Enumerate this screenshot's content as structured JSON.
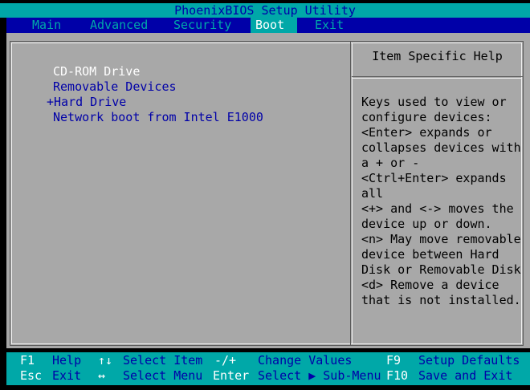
{
  "title": "PhoenixBIOS Setup Utility",
  "menu": {
    "tabs": [
      "Main",
      "Advanced",
      "Security",
      "Boot",
      "Exit"
    ],
    "active": "Boot"
  },
  "boot_order": {
    "items": [
      {
        "label": "CD-ROM Drive",
        "selected": true
      },
      {
        "label": "Removable Devices",
        "selected": false
      },
      {
        "label": "+Hard Drive",
        "selected": false
      },
      {
        "label": "Network boot from Intel E1000",
        "selected": false
      }
    ]
  },
  "help": {
    "title": "Item Specific Help",
    "lines": [
      "Keys used to view or",
      "configure devices:",
      "<Enter> expands or",
      "collapses devices with",
      "a + or -",
      "<Ctrl+Enter> expands",
      "all",
      "<+> and <-> moves the",
      "device up or down.",
      "<n> May move removable",
      "device between Hard",
      "Disk or Removable Disk",
      "<d> Remove a device",
      "that is not installed."
    ]
  },
  "footer": {
    "row1": [
      {
        "key": "F1",
        "desc": "Help"
      },
      {
        "key": "↑↓",
        "desc": "Select Item"
      },
      {
        "key": "-/+",
        "desc": "Change Values"
      },
      {
        "key": "F9",
        "desc": "Setup Defaults"
      }
    ],
    "row2": [
      {
        "key": "Esc",
        "desc": "Exit"
      },
      {
        "key": "↔",
        "desc": "Select Menu"
      },
      {
        "key": "Enter",
        "desc": "Select ▶ Sub-Menu"
      },
      {
        "key": "F10",
        "desc": "Save and Exit"
      }
    ]
  },
  "colors": {
    "bios_blue": "#0000A8",
    "bios_cyan": "#00A8A8",
    "bios_gray": "#A8A8A8",
    "highlight_white": "#FFFFFF"
  }
}
